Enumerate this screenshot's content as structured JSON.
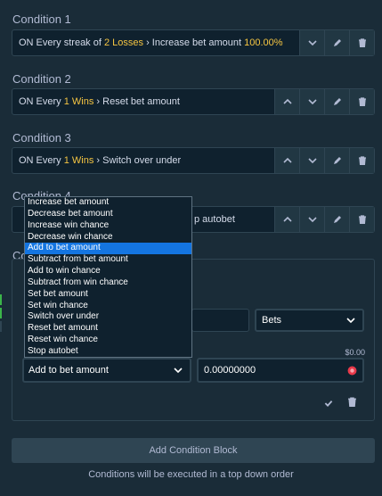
{
  "conditions": [
    {
      "label": "Condition 1",
      "pre": "ON Every streak of ",
      "count": "2 Losses",
      "action": " › Increase bet amount ",
      "value": "100.00%"
    },
    {
      "label": "Condition 2",
      "pre": "ON Every ",
      "count": "1 Wins",
      "action": " › Reset bet amount",
      "value": ""
    },
    {
      "label": "Condition 3",
      "pre": "ON Every ",
      "count": "1 Wins",
      "action": " › Switch over under",
      "value": ""
    },
    {
      "label": "Condition 4",
      "partial_text": "p autobet"
    }
  ],
  "editor": {
    "label_partial": "Co",
    "bets_select": "Bets",
    "amount_label": "$0.00",
    "action_select": "Add to bet amount",
    "amount_value": "0.00000000"
  },
  "dropdown": {
    "selected_index": 4,
    "options": [
      "Increase bet amount",
      "Decrease bet amount",
      "Increase win chance",
      "Decrease win chance",
      "Add to bet amount",
      "Subtract from bet amount",
      "Add to win chance",
      "Subtract from win chance",
      "Set bet amount",
      "Set win chance",
      "Switch over under",
      "Reset bet amount",
      "Reset win chance",
      "Stop autobet"
    ]
  },
  "add_block_label": "Add Condition Block",
  "footer_note": "Conditions will be executed in a top down order",
  "colors": {
    "background": "#1a2c38",
    "highlight": "#f5c542",
    "selected": "#1475e1",
    "coin": "#e8394a"
  }
}
